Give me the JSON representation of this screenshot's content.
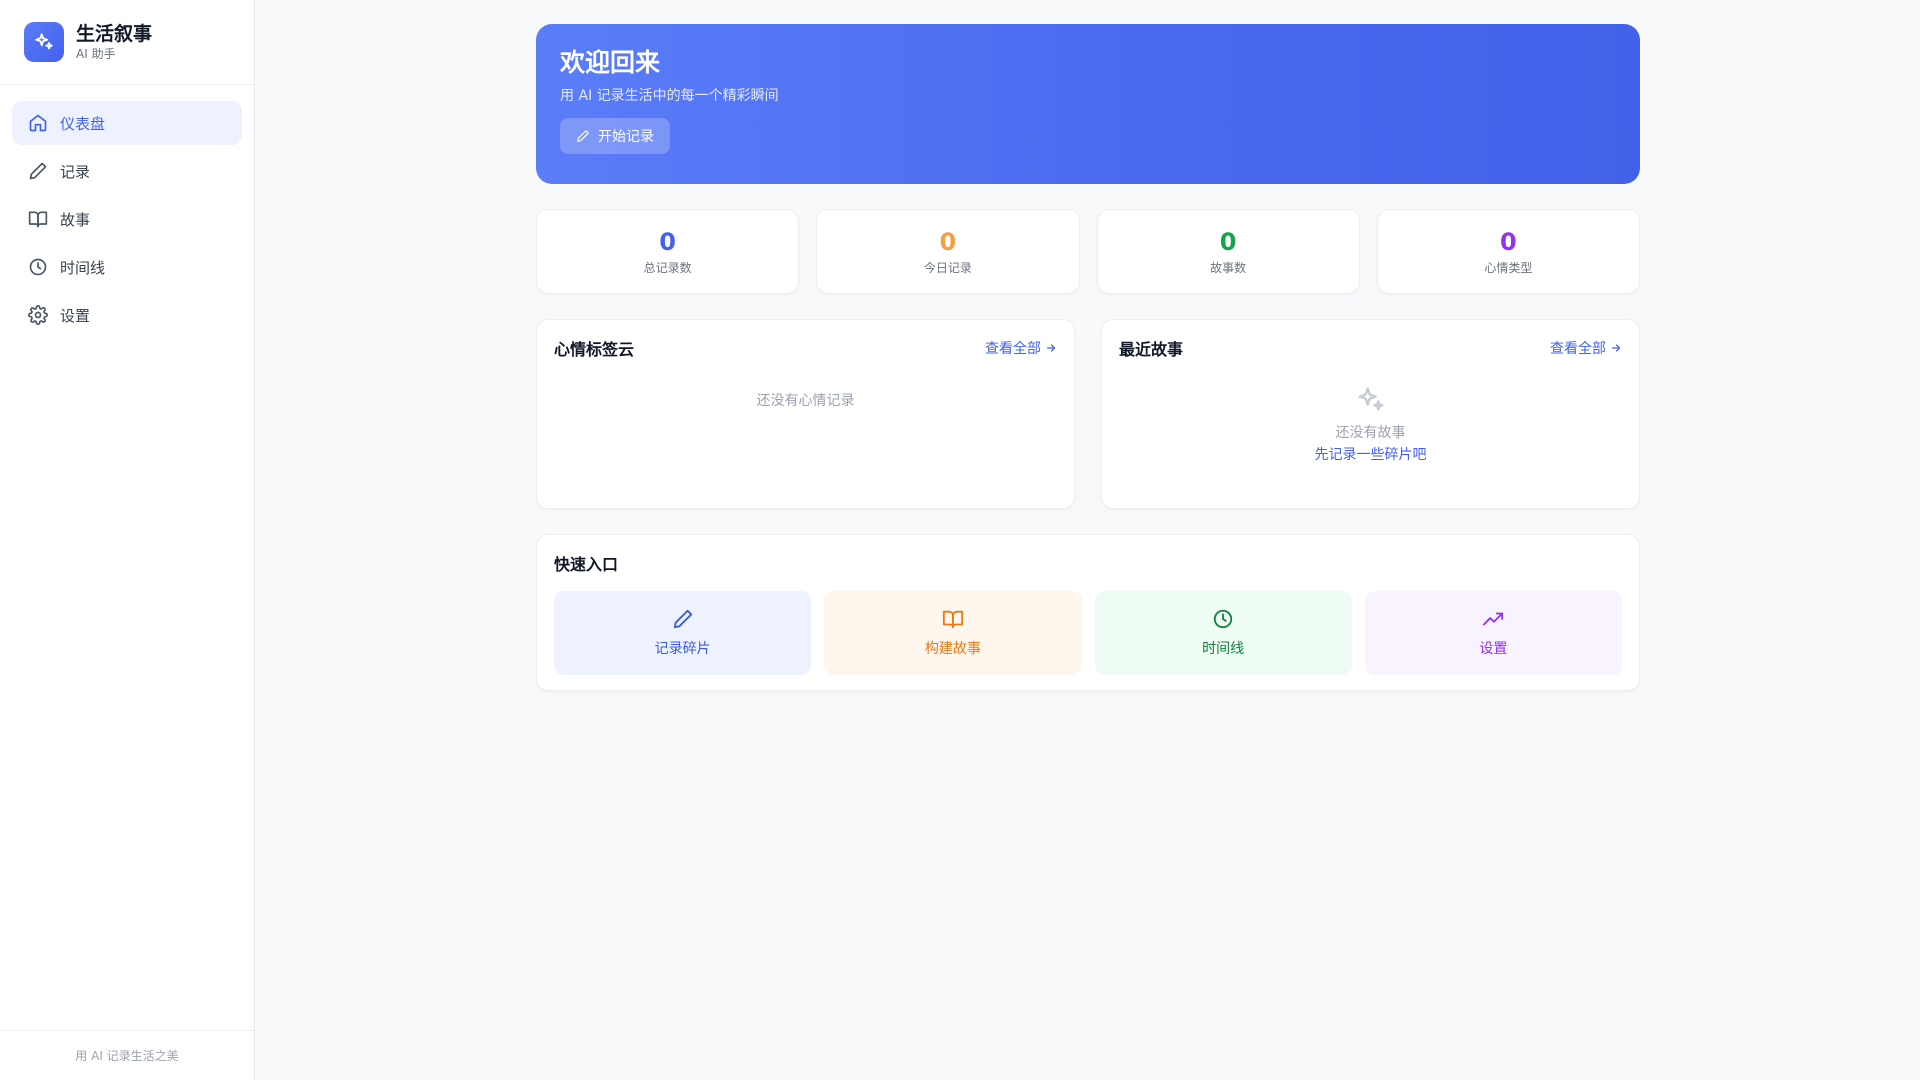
{
  "brand": {
    "title": "生活叙事",
    "subtitle": "AI 助手"
  },
  "nav": {
    "items": [
      {
        "label": "仪表盘",
        "icon": "home-icon",
        "active": true
      },
      {
        "label": "记录",
        "icon": "pen-icon"
      },
      {
        "label": "故事",
        "icon": "book-icon"
      },
      {
        "label": "时间线",
        "icon": "clock-icon"
      },
      {
        "label": "设置",
        "icon": "gear-icon"
      }
    ]
  },
  "sidebar_footer": "用 AI 记录生活之美",
  "hero": {
    "title": "欢迎回来",
    "subtitle": "用 AI 记录生活中的每一个精彩瞬间",
    "button_label": "开始记录"
  },
  "stats": [
    {
      "value": "0",
      "label": "总记录数",
      "color": "#4361ee"
    },
    {
      "value": "0",
      "label": "今日记录",
      "color": "#f59e42"
    },
    {
      "value": "0",
      "label": "故事数",
      "color": "#16a34a"
    },
    {
      "value": "0",
      "label": "心情类型",
      "color": "#9333ea"
    }
  ],
  "mood_panel": {
    "title": "心情标签云",
    "view_all": "查看全部",
    "empty": "还没有心情记录"
  },
  "stories_panel": {
    "title": "最近故事",
    "view_all": "查看全部",
    "empty": "还没有故事",
    "empty_link": "先记录一些碎片吧"
  },
  "quick": {
    "title": "快速入口",
    "items": [
      {
        "label": "记录碎片",
        "icon": "pen-icon",
        "color": "#3b5bdb"
      },
      {
        "label": "构建故事",
        "icon": "book-icon",
        "color": "#ea7a17"
      },
      {
        "label": "时间线",
        "icon": "clock-icon",
        "color": "#15803d"
      },
      {
        "label": "设置",
        "icon": "trending-up-icon",
        "color": "#9333ea"
      }
    ]
  }
}
